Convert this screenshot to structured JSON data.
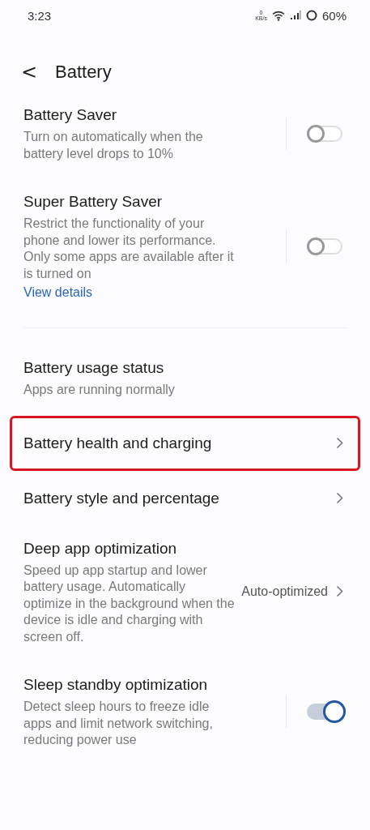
{
  "status_bar": {
    "time": "3:23",
    "speed_value": "0",
    "speed_unit": "KB/s",
    "battery": "60%"
  },
  "header": {
    "back": "<",
    "title": "Battery"
  },
  "sections": [
    {
      "items": [
        {
          "kind": "toggle",
          "title": "Battery Saver",
          "description": "Turn on automatically when the battery level drops to 10%",
          "on": false
        },
        {
          "kind": "toggle",
          "title": "Super Battery Saver",
          "description": "Restrict the functionality of your phone and lower its performance. Only some apps are available after it is turned on",
          "link": "View details",
          "on": false
        }
      ]
    },
    {
      "items": [
        {
          "kind": "status",
          "title": "Battery usage status",
          "description": "Apps are running normally"
        },
        {
          "kind": "nav",
          "title": "Battery health and charging",
          "highlighted": true
        },
        {
          "kind": "nav",
          "title": "Battery style and percentage",
          "highlighted": false
        },
        {
          "kind": "nav",
          "title": "Deep app optimization",
          "description": "Speed up app startup and lower battery usage. Automatically optimize in the background when the device is idle and charging with screen off.",
          "value": "Auto-optimized",
          "highlighted": false
        },
        {
          "kind": "toggle",
          "title": "Sleep standby optimization",
          "description": "Detect sleep hours to freeze idle apps and limit network switching, reducing power use",
          "on": true
        }
      ]
    }
  ]
}
